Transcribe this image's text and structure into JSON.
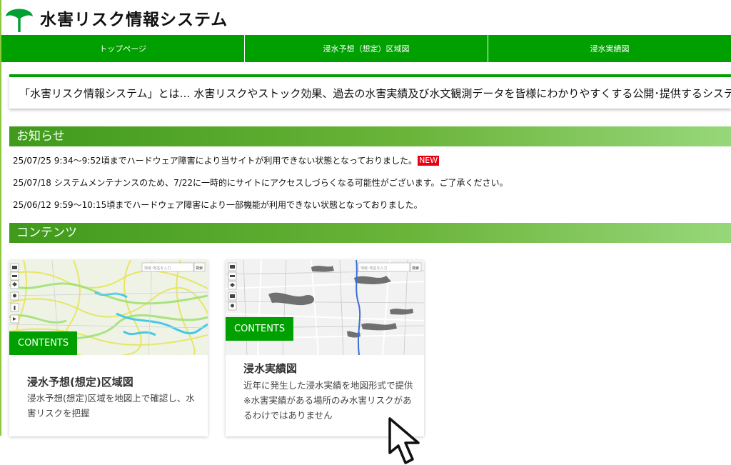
{
  "header": {
    "site_title": "水害リスク情報システム",
    "logo_icon": "ginkgo-leaf-icon",
    "brand_color": "#00a000"
  },
  "nav": {
    "items": [
      {
        "label": "トップページ"
      },
      {
        "label": "浸水予想（想定）区域図"
      },
      {
        "label": "浸水実績図"
      }
    ]
  },
  "intro": {
    "text": "「水害リスク情報システム」とは… 水害リスクやストック効果、過去の水害実績及び水文観測データを皆様にわかりやすくする公開･提供するシステムです。"
  },
  "notices": {
    "heading": "お知らせ",
    "new_badge": "NEW",
    "items": [
      {
        "text": "25/07/25 9:34～9:52頃までハードウェア障害により当サイトが利用できない状態となっておりました。",
        "is_new": true
      },
      {
        "text": "25/07/18 システムメンテナンスのため、7/22に一時的にサイトにアクセスしづらくなる可能性がございます。ご了承ください。",
        "is_new": false
      },
      {
        "text": "25/06/12 9:59～10:15頃までハードウェア障害により一部機能が利用できない状態となっておりました。",
        "is_new": false
      }
    ]
  },
  "contents": {
    "heading": "コンテンツ",
    "cards": [
      {
        "tag": "CONTENTS",
        "title": "浸水予想(想定)区域図",
        "description": "浸水予想(想定)区域を地図上で確認し、水害リスクを把握",
        "map_search_placeholder": "地域･地名を入力",
        "map_search_button": "検索"
      },
      {
        "tag": "CONTENTS",
        "title": "浸水実績図",
        "description": "近年に発生した浸水実績を地図形式で提供※水害実績がある場所のみ水害リスクがあるわけではありません",
        "map_search_placeholder": "地域･地名を入力",
        "map_search_button": "検索"
      }
    ]
  },
  "cursor_icon": "mouse-pointer-icon"
}
